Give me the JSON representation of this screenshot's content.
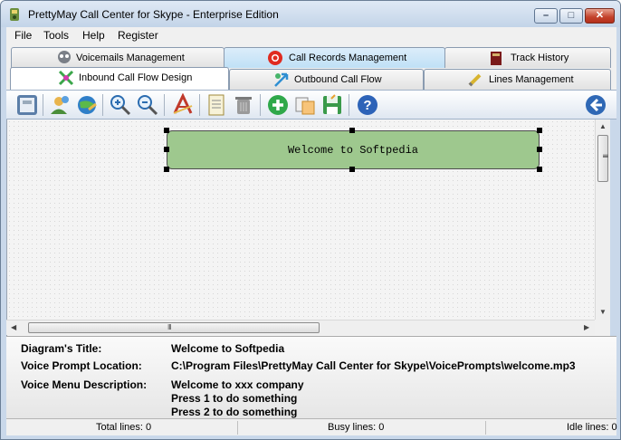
{
  "window": {
    "title": "PrettyMay Call Center for Skype - Enterprise Edition",
    "minimize_glyph": "–",
    "maximize_glyph": "□",
    "close_glyph": "✕"
  },
  "menu": {
    "items": [
      "File",
      "Tools",
      "Help",
      "Register"
    ]
  },
  "tabs": {
    "row_back": [
      {
        "label": "Voicemails Management",
        "icon": "voicemail-icon"
      },
      {
        "label": "Call Records Management",
        "icon": "record-icon"
      },
      {
        "label": "Track History",
        "icon": "book-icon"
      }
    ],
    "row_front": [
      {
        "label": "Inbound Call Flow Design",
        "icon": "flow-icon",
        "selected": true
      },
      {
        "label": "Outbound Call Flow",
        "icon": "outbound-icon"
      },
      {
        "label": "Lines Management",
        "icon": "pen-icon"
      }
    ]
  },
  "toolbar": {
    "buttons": [
      "calculator-icon",
      "user-add-icon",
      "globe-phone-icon",
      "zoom-in-icon",
      "zoom-out-icon",
      "text-icon",
      "notepad-icon",
      "trash-icon",
      "add-icon",
      "copy-icon",
      "save-icon",
      "help-icon",
      "back-icon"
    ]
  },
  "diagram": {
    "node_text": "Welcome to Softpedia",
    "node_color": "#9ec88e"
  },
  "details": {
    "title_label": "Diagram's Title:",
    "title_value": "Welcome to Softpedia",
    "prompt_label": "Voice Prompt Location:",
    "prompt_value": "C:\\Program Files\\PrettyMay Call Center for Skype\\VoicePrompts\\welcome.mp3",
    "menu_label": "Voice Menu Description:",
    "menu_lines": [
      "Welcome to xxx company",
      "Press 1 to do something",
      "Press 2 to do something"
    ]
  },
  "status": {
    "total": "Total lines: 0",
    "busy": "Busy lines: 0",
    "idle": "Idle lines: 0"
  },
  "scrollbar_grip": "III"
}
